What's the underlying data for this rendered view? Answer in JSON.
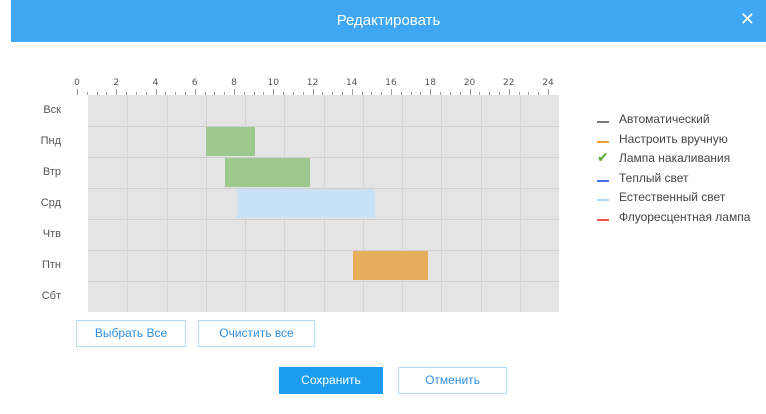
{
  "dialog": {
    "title": "Редактировать",
    "close_icon": "close-icon"
  },
  "hours": [
    "0",
    "2",
    "4",
    "6",
    "8",
    "10",
    "12",
    "14",
    "16",
    "18",
    "20",
    "22",
    "24"
  ],
  "days": [
    "Вск",
    "Пнд",
    "Втр",
    "Срд",
    "Чтв",
    "Птн",
    "Сбт"
  ],
  "schedule": [
    {
      "day_index": 1,
      "start": 6.0,
      "end": 8.5,
      "color": "#9cc88d"
    },
    {
      "day_index": 2,
      "start": 7.0,
      "end": 11.3,
      "color": "#9cc88d"
    },
    {
      "day_index": 3,
      "start": 7.6,
      "end": 14.6,
      "color": "#c9e1f5"
    },
    {
      "day_index": 5,
      "start": 13.5,
      "end": 17.3,
      "color": "#e6ad5a"
    }
  ],
  "legend": [
    {
      "label": "Автоматический",
      "color": "#7b7b7b",
      "selected": false
    },
    {
      "label": "Настроить вручную",
      "color": "#f0a030",
      "selected": false
    },
    {
      "label": "Лампа накаливания",
      "color": "#58a832",
      "selected": true
    },
    {
      "label": "Теплый свет",
      "color": "#4b6fe8",
      "selected": false
    },
    {
      "label": "Естественный свет",
      "color": "#b8dcf7",
      "selected": false
    },
    {
      "label": "Флуоресцентная лампа",
      "color": "#ef5350",
      "selected": false
    }
  ],
  "buttons": {
    "select_all": "Выбрать Все",
    "clear_all": "Очистить все",
    "save": "Сохранить",
    "cancel": "Отменить"
  }
}
